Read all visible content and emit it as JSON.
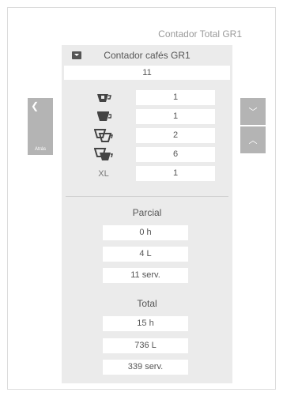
{
  "screen_title": "Contador Total GR1",
  "panel": {
    "title": "Contador cafés GR1",
    "total": "11"
  },
  "counters": [
    {
      "icon": "small-cup-icon",
      "value": "1"
    },
    {
      "icon": "medium-cup-icon",
      "value": "1"
    },
    {
      "icon": "double-cup-icon",
      "value": "2"
    },
    {
      "icon": "double-cup-large-icon",
      "value": "6"
    },
    {
      "label": "XL",
      "value": "1"
    }
  ],
  "parcial": {
    "title": "Parcial",
    "hours": "0 h",
    "liters": "4 L",
    "services": "11 serv."
  },
  "total": {
    "title": "Total",
    "hours": "15 h",
    "liters": "736 L",
    "services": "339 serv."
  },
  "nav": {
    "back_label": "Atrás",
    "back_icon": "chevron-left-icon",
    "up_icon": "chevron-up-icon",
    "down_icon": "chevron-down-icon"
  },
  "colors": {
    "panel_bg": "#ebebeb",
    "nav_bg": "#b4b4b4",
    "icon": "#444444"
  }
}
